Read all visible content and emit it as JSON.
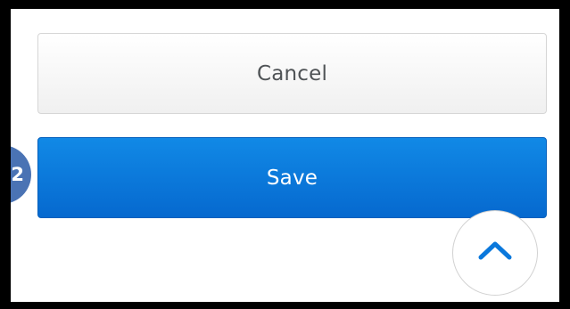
{
  "buttons": {
    "cancel_label": "Cancel",
    "save_label": "Save"
  },
  "step_badge": {
    "number": "2"
  },
  "scroll_top": {
    "icon": "chevron-up-icon"
  },
  "colors": {
    "primary": "#0a78dc",
    "cancel_text": "#4f5356",
    "badge": "#4a73b4",
    "frame": "#000000"
  }
}
